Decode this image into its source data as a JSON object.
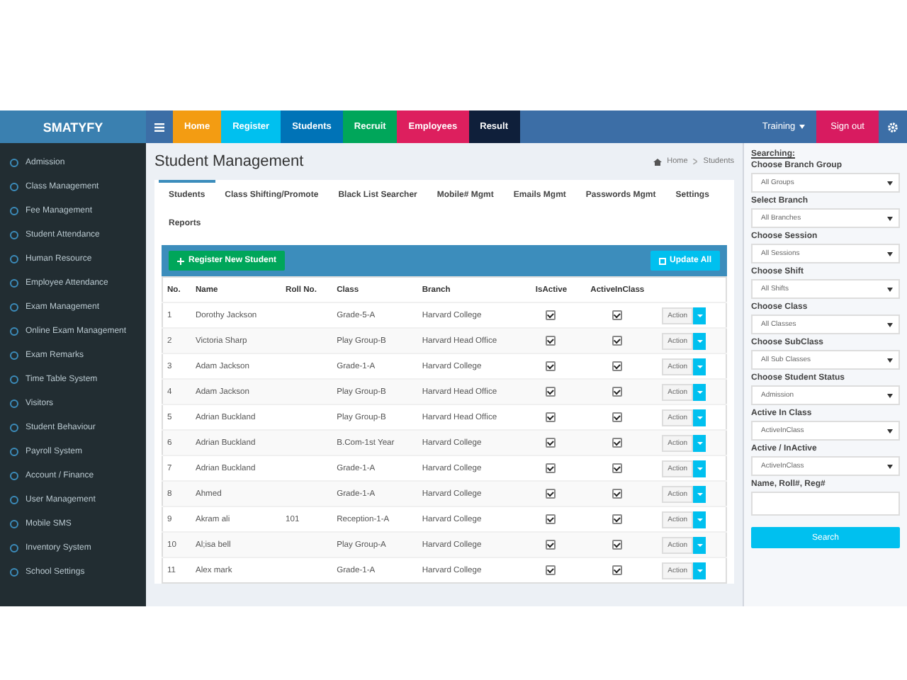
{
  "brand": "SMATYFY",
  "nav": [
    {
      "label": "Home",
      "color": "#f39c12"
    },
    {
      "label": "Register",
      "color": "#00c0ef"
    },
    {
      "label": "Students",
      "color": "#0073b7"
    },
    {
      "label": "Recruit",
      "color": "#00a65a"
    },
    {
      "label": "Employees",
      "color": "#dd1f5e"
    },
    {
      "label": "Result",
      "color": "#0f1f3a"
    }
  ],
  "training": "Training",
  "signout": "Sign out",
  "sidebar": [
    "Admission",
    "Class Management",
    "Fee Management",
    "Student Attendance",
    "Human Resource",
    "Employee Attendance",
    "Exam Management",
    "Online Exam Management",
    "Exam Remarks",
    "Time Table System",
    "Visitors",
    "Student Behaviour",
    "Payroll System",
    "Account / Finance",
    "User Management",
    "Mobile SMS",
    "Inventory System",
    "School Settings"
  ],
  "page_title": "Student Management",
  "breadcrumb": [
    "Home",
    "Students"
  ],
  "tabs": [
    {
      "label": "Students",
      "selected": true
    },
    {
      "label": "Class Shifting/Promote",
      "selected": false
    },
    {
      "label": "Black List Searcher",
      "selected": false
    },
    {
      "label": "Mobile# Mgmt",
      "selected": false
    },
    {
      "label": "Emails Mgmt",
      "selected": false
    },
    {
      "label": "Passwords Mgmt",
      "selected": false
    },
    {
      "label": "Settings",
      "selected": false
    },
    {
      "label": "Reports",
      "selected": false
    }
  ],
  "register_button": "Register New Student",
  "update_button": "Update All",
  "table": {
    "columns": [
      "No.",
      "Name",
      "Roll No.",
      "Class",
      "Branch",
      "IsActive",
      "ActiveInClass"
    ],
    "rows": [
      {
        "no": "1",
        "name": "Dorothy Jackson",
        "roll": "",
        "class": "Grade-5-A",
        "branch": "Harvard College",
        "is_active": true,
        "active_in_class": true,
        "action": "Action"
      },
      {
        "no": "2",
        "name": "Victoria Sharp",
        "roll": "",
        "class": "Play Group-B",
        "branch": "Harvard Head Office",
        "is_active": true,
        "active_in_class": true,
        "action": "Action"
      },
      {
        "no": "3",
        "name": "Adam Jackson",
        "roll": "",
        "class": "Grade-1-A",
        "branch": "Harvard College",
        "is_active": true,
        "active_in_class": true,
        "action": "Action"
      },
      {
        "no": "4",
        "name": "Adam Jackson",
        "roll": "",
        "class": "Play Group-B",
        "branch": "Harvard Head Office",
        "is_active": true,
        "active_in_class": true,
        "action": "Action"
      },
      {
        "no": "5",
        "name": "Adrian Buckland",
        "roll": "",
        "class": "Play Group-B",
        "branch": "Harvard Head Office",
        "is_active": true,
        "active_in_class": true,
        "action": "Action"
      },
      {
        "no": "6",
        "name": "Adrian Buckland",
        "roll": "",
        "class": "B.Com-1st Year",
        "branch": "Harvard College",
        "is_active": true,
        "active_in_class": true,
        "action": "Action"
      },
      {
        "no": "7",
        "name": "Adrian Buckland",
        "roll": "",
        "class": "Grade-1-A",
        "branch": "Harvard College",
        "is_active": true,
        "active_in_class": true,
        "action": "Action"
      },
      {
        "no": "8",
        "name": "Ahmed",
        "roll": "",
        "class": "Grade-1-A",
        "branch": "Harvard College",
        "is_active": true,
        "active_in_class": true,
        "action": "Action"
      },
      {
        "no": "9",
        "name": "Akram ali",
        "roll": "101",
        "class": "Reception-1-A",
        "branch": "Harvard College",
        "is_active": true,
        "active_in_class": true,
        "action": "Action"
      },
      {
        "no": "10",
        "name": "Al;isa bell",
        "roll": "",
        "class": "Play Group-A",
        "branch": "Harvard College",
        "is_active": true,
        "active_in_class": true,
        "action": "Action"
      },
      {
        "no": "11",
        "name": "Alex mark",
        "roll": "",
        "class": "Grade-1-A",
        "branch": "Harvard College",
        "is_active": true,
        "active_in_class": true,
        "action": "Action"
      }
    ]
  },
  "search": {
    "heading": "Searching:",
    "fields": [
      {
        "kind": "select",
        "label": "Choose Branch Group",
        "value": "All Groups"
      },
      {
        "kind": "select",
        "label": "Select Branch",
        "value": "All Branches"
      },
      {
        "kind": "select",
        "label": "Choose Session",
        "value": "All Sessions"
      },
      {
        "kind": "select",
        "label": "Choose Shift",
        "value": "All Shifts"
      },
      {
        "kind": "select",
        "label": "Choose Class",
        "value": "All Classes"
      },
      {
        "kind": "select",
        "label": "Choose SubClass",
        "value": "All Sub Classes"
      },
      {
        "kind": "select",
        "label": "Choose Student Status",
        "value": "Admission"
      },
      {
        "kind": "select",
        "label": "Active In Class",
        "value": "ActiveInClass"
      },
      {
        "kind": "select",
        "label": "Active / InActive",
        "value": "ActiveInClass"
      },
      {
        "kind": "text",
        "label": "Name, Roll#, Reg#"
      }
    ],
    "button": "Search"
  }
}
